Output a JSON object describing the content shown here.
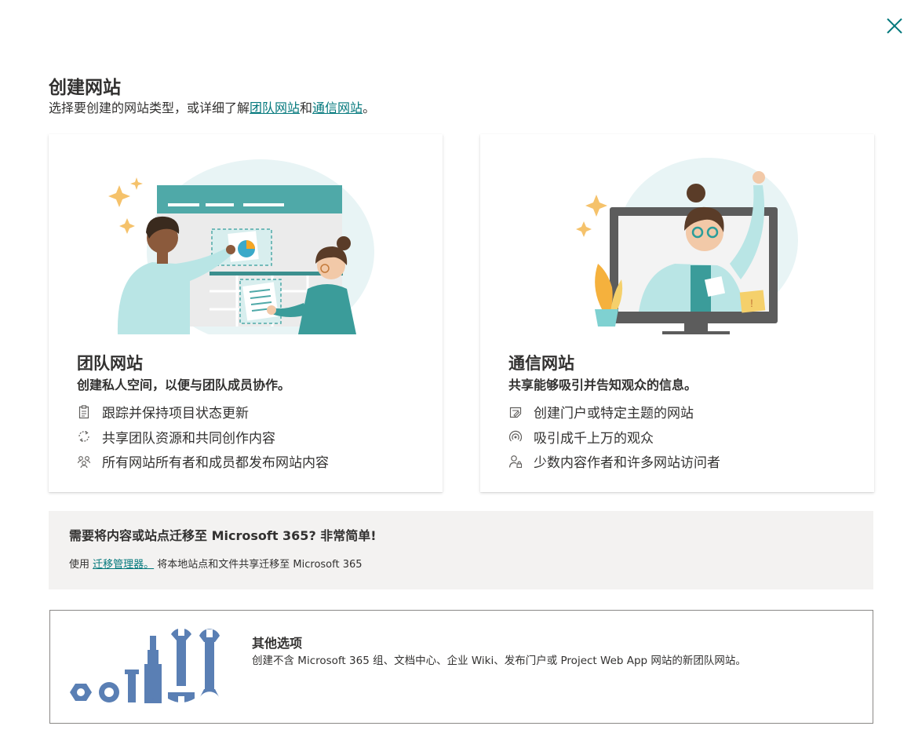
{
  "dialog": {
    "title": "创建网站",
    "subtitle_prefix": "选择要创建的网站类型，或详细了解",
    "subtitle_link_team": "团队网站",
    "subtitle_and": "和",
    "subtitle_link_comm": "通信网站",
    "subtitle_suffix": "。"
  },
  "team_site": {
    "title": "团队网站",
    "description": "创建私人空间，以便与团队成员协作。",
    "features": [
      {
        "icon": "clipboard-icon",
        "label": "跟踪并保持项目状态更新"
      },
      {
        "icon": "sync-icon",
        "label": "共享团队资源和共同创作内容"
      },
      {
        "icon": "people-icon",
        "label": "所有网站所有者和成员都发布网站内容"
      }
    ]
  },
  "communication_site": {
    "title": "通信网站",
    "description": "共享能够吸引并告知观众的信息。",
    "features": [
      {
        "icon": "page-edit-icon",
        "label": "创建门户或特定主题的网站"
      },
      {
        "icon": "broadcast-icon",
        "label": "吸引成千上万的观众"
      },
      {
        "icon": "person-lock-icon",
        "label": "少数内容作者和许多网站访问者"
      }
    ]
  },
  "migration": {
    "title": "需要将内容或站点迁移至 Microsoft 365? 非常简单!",
    "text_prefix": "使用 ",
    "link": "迁移管理器。",
    "text_suffix": " 将本地站点和文件共享迁移至 Microsoft 365"
  },
  "other_options": {
    "title": "其他选项",
    "description": "创建不含 Microsoft 365 组、文档中心、企业 Wiki、发布门户或 Project Web App 网站的新团队网站。"
  },
  "colors": {
    "accent": "#03787c",
    "teal": "#4fb3b3",
    "tools_blue": "#5a7fb4"
  }
}
